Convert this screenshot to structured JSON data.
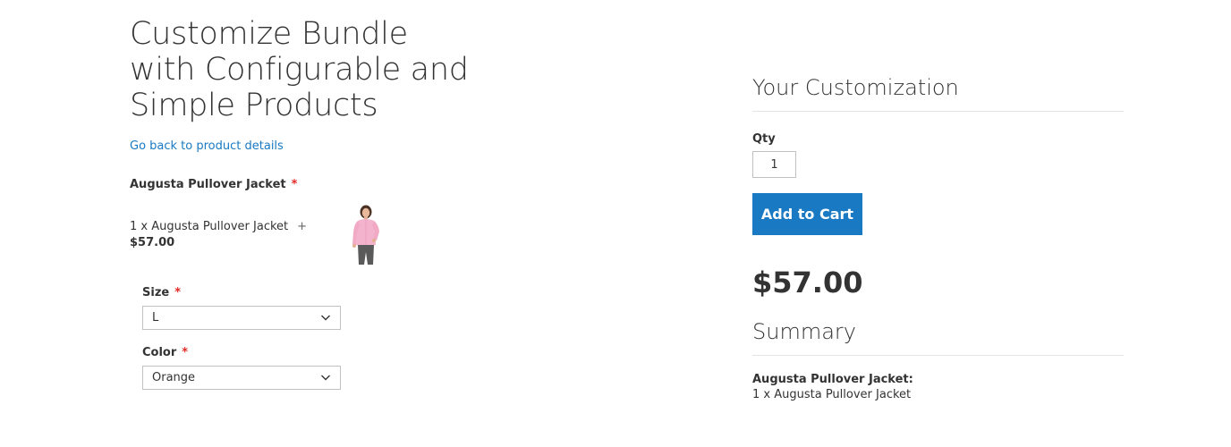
{
  "page": {
    "title_lines": [
      "Customize Bundle",
      "with Configurable and",
      "Simple Products"
    ],
    "back_link": "Go back to product details"
  },
  "bundle_option": {
    "title": "Augusta Pullover Jacket",
    "required_mark": "*",
    "product": {
      "line": "1 x Augusta Pullover Jacket",
      "plus": "+",
      "price": "$57.00",
      "image_icon": "pink-jacket-model-image"
    },
    "fields": [
      {
        "label": "Size",
        "required_mark": "*",
        "value": "L"
      },
      {
        "label": "Color",
        "required_mark": "*",
        "value": "Orange"
      }
    ]
  },
  "customization": {
    "title": "Your Customization",
    "qty_label": "Qty",
    "qty_value": "1",
    "add_to_cart": "Add to Cart",
    "price": "$57.00"
  },
  "summary": {
    "title": "Summary",
    "item_label": "Augusta Pullover Jacket:",
    "item_value": "1 x Augusta Pullover Jacket"
  },
  "colors": {
    "accent": "#1979c3",
    "required": "#e02b27",
    "text": "#333333",
    "divider": "#e4e4e4",
    "jacket": "#f3b3cc"
  }
}
